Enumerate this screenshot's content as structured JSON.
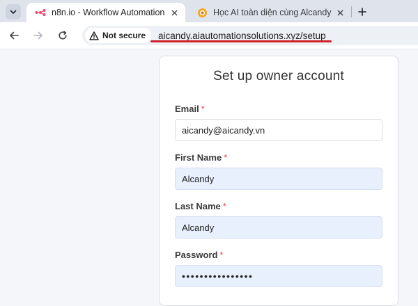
{
  "browser": {
    "tabs": [
      {
        "title": "n8n.io - Workflow Automation",
        "favicon": "n8n-logo",
        "active": true
      },
      {
        "title": "Học AI toàn diện cùng Alcandy",
        "favicon": "aicandy-logo",
        "active": false
      }
    ],
    "security_label": "Not secure",
    "url": "aicandy.aiautomationsolutions.xyz/setup",
    "accent_color": "#d0202a"
  },
  "form": {
    "title": "Set up owner account",
    "required_mark": "*",
    "fields": [
      {
        "label": "Email",
        "value": "aicandy@aicandy.vn",
        "type": "email"
      },
      {
        "label": "First Name",
        "value": "Alcandy",
        "type": "text"
      },
      {
        "label": "Last Name",
        "value": "Alcandy",
        "type": "text"
      },
      {
        "label": "Password",
        "value": "••••••••••••••••",
        "type": "password"
      }
    ]
  }
}
